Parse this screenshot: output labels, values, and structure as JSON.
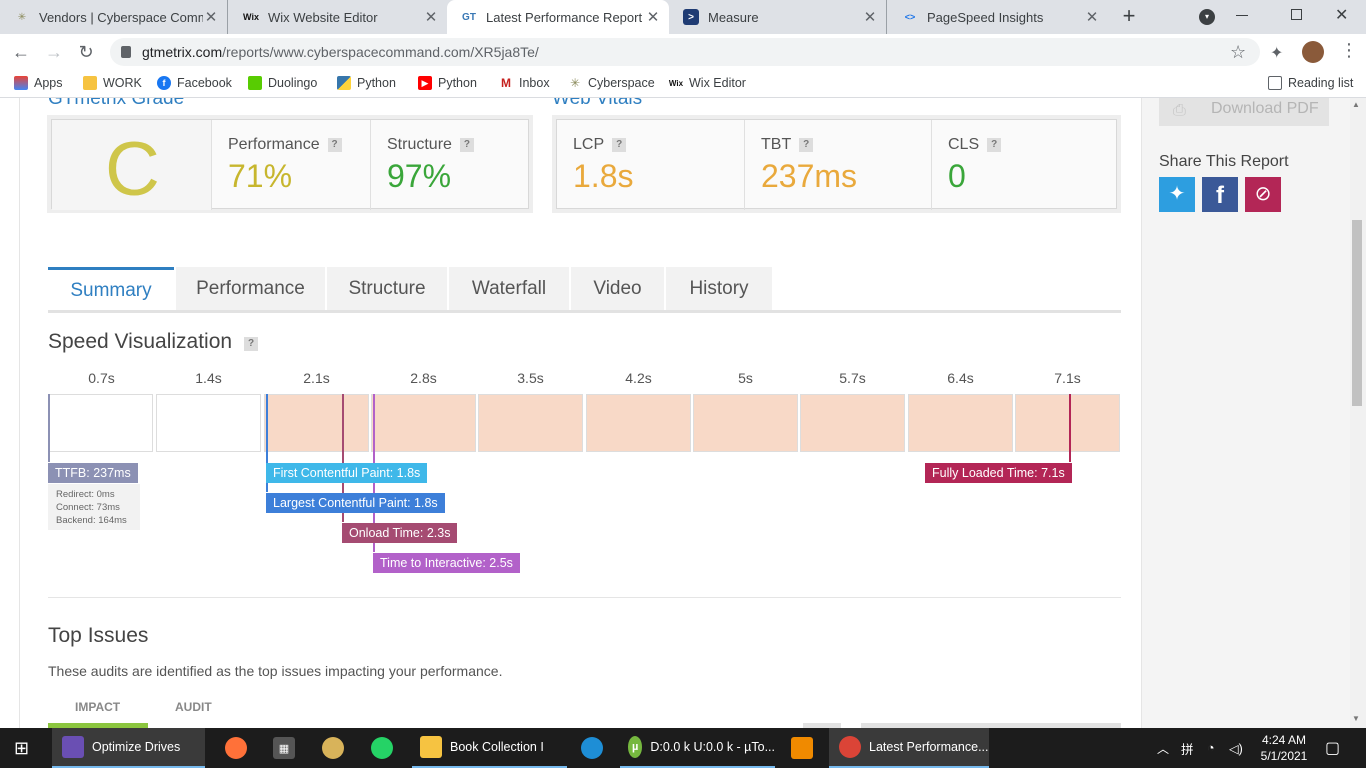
{
  "browser": {
    "tabs": [
      {
        "title": "Vendors | Cyberspace Comma",
        "fav": "✳"
      },
      {
        "title": "Wix Website Editor",
        "fav": "Wix"
      },
      {
        "title": "Latest Performance Report fo",
        "fav": "GT"
      },
      {
        "title": "Measure",
        "fav": ">"
      },
      {
        "title": "PageSpeed Insights",
        "fav": "<>"
      }
    ],
    "new_tab": "+",
    "url_host": "gtmetrix.com",
    "url_path": "/reports/www.cyberspacecommand.com/XR5ja8Te/",
    "bookmarks": [
      {
        "label": "Apps"
      },
      {
        "label": "WORK"
      },
      {
        "label": "Facebook"
      },
      {
        "label": "Duolingo"
      },
      {
        "label": "Python"
      },
      {
        "label": "Python"
      },
      {
        "label": "Inbox"
      },
      {
        "label": "Cyberspace"
      },
      {
        "label": "Wix Editor"
      }
    ],
    "reading_list": "Reading list"
  },
  "grade": {
    "heading": "GTmetrix Grade",
    "letter": "C",
    "performance_label": "Performance",
    "performance_value": "71%",
    "structure_label": "Structure",
    "structure_value": "97%"
  },
  "vitals": {
    "heading": "Web Vitals",
    "lcp_label": "LCP",
    "lcp_value": "1.8s",
    "tbt_label": "TBT",
    "tbt_value": "237ms",
    "cls_label": "CLS",
    "cls_value": "0"
  },
  "sidebar": {
    "download": "Download PDF",
    "share_title": "Share This Report"
  },
  "report_tabs": [
    "Summary",
    "Performance",
    "Structure",
    "Waterfall",
    "Video",
    "History"
  ],
  "speed": {
    "title": "Speed Visualization",
    "ticks": [
      "0.7s",
      "1.4s",
      "2.1s",
      "2.8s",
      "3.5s",
      "4.2s",
      "5s",
      "5.7s",
      "6.4s",
      "7.1s"
    ],
    "ttfb": "TTFB: 237ms",
    "ttfb_details": [
      "Redirect: 0ms",
      "Connect: 73ms",
      "Backend: 164ms"
    ],
    "fcp": "First Contentful Paint: 1.8s",
    "lcp": "Largest Contentful Paint: 1.8s",
    "onload": "Onload Time: 2.3s",
    "tti": "Time to Interactive: 2.5s",
    "fully_loaded": "Fully Loaded Time: 7.1s",
    "colors": {
      "ttfb": "#8c91b4",
      "fcp": "#3fb8e9",
      "lcp": "#3d7fd9",
      "onload": "#a54b72",
      "tti": "#b261c9",
      "fully": "#b32656"
    }
  },
  "issues": {
    "title": "Top Issues",
    "description": "These audits are identified as the top issues impacting your performance.",
    "col_impact": "IMPACT",
    "col_audit": "AUDIT"
  },
  "taskbar": {
    "items": [
      "Optimize Drives",
      "Book Collection I",
      "D:0.0 k U:0.0 k - µTo...",
      "Latest Performance..."
    ],
    "tray_lang": "拼",
    "time": "4:24 AM",
    "date": "5/1/2021"
  }
}
